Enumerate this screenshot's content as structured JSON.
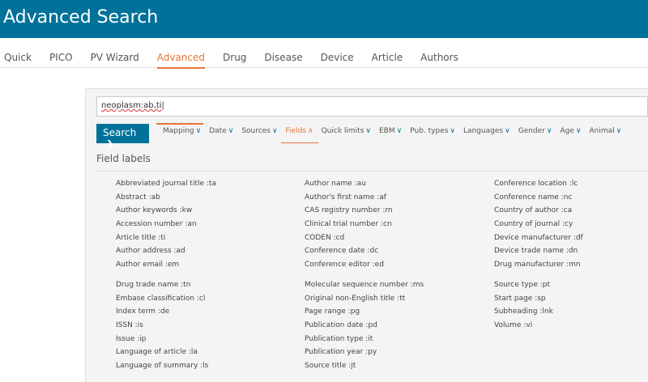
{
  "header": {
    "title": "Advanced Search"
  },
  "tabs": [
    "Quick",
    "PICO",
    "PV Wizard",
    "Advanced",
    "Drug",
    "Disease",
    "Device",
    "Article",
    "Authors"
  ],
  "search": {
    "query": "neoplasm:ab,ti",
    "button": "Search",
    "button_icon": "chevron-right-icon"
  },
  "filters": [
    {
      "label": "Mapping",
      "icon": "v"
    },
    {
      "label": "Date",
      "icon": "v"
    },
    {
      "label": "Sources",
      "icon": "v"
    },
    {
      "label": "Fields",
      "icon": "^"
    },
    {
      "label": "Quick limits",
      "icon": "v"
    },
    {
      "label": "EBM",
      "icon": "v"
    },
    {
      "label": "Pub. types",
      "icon": "v"
    },
    {
      "label": "Languages",
      "icon": "v"
    },
    {
      "label": "Gender",
      "icon": "v"
    },
    {
      "label": "Age",
      "icon": "v"
    },
    {
      "label": "Animal",
      "icon": "v"
    }
  ],
  "field_labels": {
    "title": "Field labels",
    "columns": [
      [
        "Abbreviated journal title :ta",
        "Abstract :ab",
        "Author keywords :kw",
        "Accession number :an",
        "Article title :ti",
        "Author address :ad",
        "Author email :em",
        "",
        "Drug trade name :tn",
        "Embase classification :cl",
        "Index term :de",
        "ISSN :is",
        "Issue :ip",
        "Language of article :la",
        "Language of summary :ls"
      ],
      [
        "Author name :au",
        "Author's first name :af",
        "CAS registry number :rn",
        "Clinical trial number :cn",
        "CODEN :cd",
        "Conference date :dc",
        "Conference editor :ed",
        "",
        "Molecular sequence number :ms",
        "Original non-English title :tt",
        "Page range :pg",
        "Publication date :pd",
        "Publication type :it",
        "Publication year :py",
        "Source title :jt"
      ],
      [
        "Conference location :lc",
        "Conference name :nc",
        "Country of author :ca",
        "Country of journal :cy",
        "Device manufacturer :df",
        "Device trade name :dn",
        "Drug manufacturer :mn",
        "",
        "Source type :pt",
        "Start page :sp",
        "Subheading :lnk",
        "Volume :vi"
      ]
    ]
  }
}
